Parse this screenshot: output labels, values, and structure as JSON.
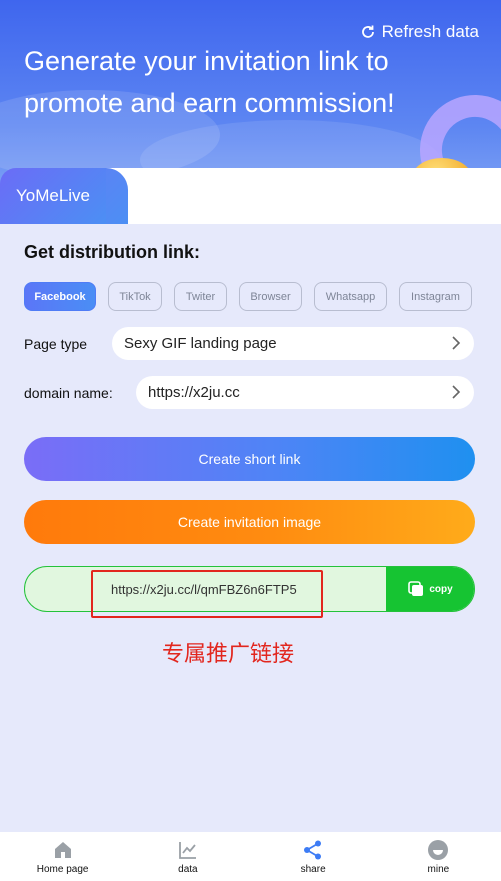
{
  "header": {
    "refresh_label": "Refresh data",
    "headline": "Generate your invitation link to promote and earn commission!",
    "brand_tab": "YoMeLive"
  },
  "distribution": {
    "title": "Get distribution link:",
    "platforms": [
      "Facebook",
      "TikTok",
      "Twiter",
      "Browser",
      "Whatsapp",
      "Instagram"
    ],
    "active_platform": "Facebook",
    "page_type_label": "Page type",
    "page_type_value": "Sexy GIF landing page",
    "domain_label": "domain name:",
    "domain_value": "https://x2ju.cc"
  },
  "actions": {
    "create_short_link": "Create short link",
    "create_invitation_image": "Create invitation image"
  },
  "link_result": {
    "url": "https://x2ju.cc/l/qmFBZ6n6FTP5",
    "copy_label": "copy",
    "caption": "专属推广链接"
  },
  "bottom_nav": {
    "items": [
      {
        "label": "Home page",
        "icon": "home-icon",
        "color": "#9aa0a6"
      },
      {
        "label": "data",
        "icon": "chart-icon",
        "color": "#9aa0a6"
      },
      {
        "label": "share",
        "icon": "share-icon",
        "color": "#3d7cf5"
      },
      {
        "label": "mine",
        "icon": "user-icon",
        "color": "#9aa0a6"
      }
    ]
  },
  "colors": {
    "accent_blue": "#4f84f6",
    "accent_orange": "#ff8c10",
    "accent_green": "#16c432",
    "annotation_red": "#e2261e"
  }
}
